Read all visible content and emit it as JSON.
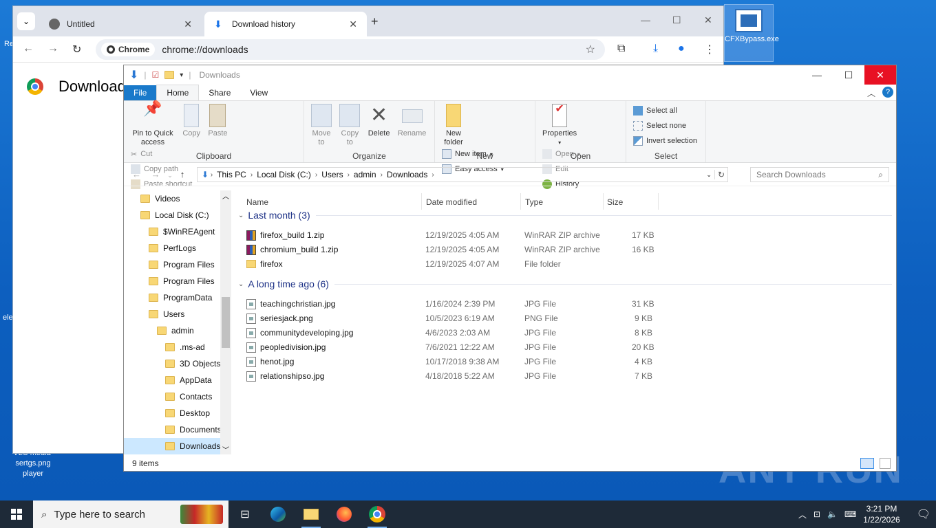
{
  "desktop": {
    "watermark": "ANY RUN",
    "file_icon_label": "CFXBypass.exe",
    "left_labels": [
      "Re",
      "ele",
      "VLC media",
      "player",
      "sertgs.png"
    ]
  },
  "chrome": {
    "tabs": [
      {
        "label": "Untitled"
      },
      {
        "label": "Download history"
      }
    ],
    "chip_label": "Chrome",
    "url": "chrome://downloads",
    "page_title": "Downloads"
  },
  "explorer": {
    "title": "Downloads",
    "ribbon_tabs": [
      "File",
      "Home",
      "Share",
      "View"
    ],
    "clipboard": {
      "pin": "Pin to Quick access",
      "copy": "Copy",
      "paste": "Paste",
      "cut": "Cut",
      "copy_path": "Copy path",
      "paste_shortcut": "Paste shortcut",
      "label": "Clipboard"
    },
    "organize": {
      "move_to": "Move to",
      "copy_to": "Copy to",
      "delete": "Delete",
      "rename": "Rename",
      "label": "Organize"
    },
    "new": {
      "new_folder": "New folder",
      "new_item": "New item",
      "easy_access": "Easy access",
      "label": "New"
    },
    "open": {
      "properties": "Properties",
      "open": "Open",
      "edit": "Edit",
      "history": "History",
      "label": "Open"
    },
    "select": {
      "select_all": "Select all",
      "select_none": "Select none",
      "invert": "Invert selection",
      "label": "Select"
    },
    "breadcrumb": [
      "This PC",
      "Local Disk (C:)",
      "Users",
      "admin",
      "Downloads"
    ],
    "search_placeholder": "Search Downloads",
    "nav": [
      {
        "label": "Videos",
        "indent": 1
      },
      {
        "label": "Local Disk (C:)",
        "indent": 1
      },
      {
        "label": "$WinREAgent",
        "indent": 2
      },
      {
        "label": "PerfLogs",
        "indent": 2
      },
      {
        "label": "Program Files",
        "indent": 2
      },
      {
        "label": "Program Files",
        "indent": 2
      },
      {
        "label": "ProgramData",
        "indent": 2
      },
      {
        "label": "Users",
        "indent": 2
      },
      {
        "label": "admin",
        "indent": 3
      },
      {
        "label": ".ms-ad",
        "indent": 4
      },
      {
        "label": "3D Objects",
        "indent": 4
      },
      {
        "label": "AppData",
        "indent": 4
      },
      {
        "label": "Contacts",
        "indent": 4
      },
      {
        "label": "Desktop",
        "indent": 4
      },
      {
        "label": "Documents",
        "indent": 4
      },
      {
        "label": "Downloads",
        "indent": 4
      }
    ],
    "columns": [
      "Name",
      "Date modified",
      "Type",
      "Size"
    ],
    "groups": [
      {
        "title": "Last month (3)",
        "files": [
          {
            "name": "firefox_build 1.zip",
            "date": "12/19/2025 4:05 AM",
            "type": "WinRAR ZIP archive",
            "size": "17 KB",
            "icon": "zip"
          },
          {
            "name": "chromium_build 1.zip",
            "date": "12/19/2025 4:05 AM",
            "type": "WinRAR ZIP archive",
            "size": "16 KB",
            "icon": "zip"
          },
          {
            "name": "firefox",
            "date": "12/19/2025 4:07 AM",
            "type": "File folder",
            "size": "",
            "icon": "folder"
          }
        ]
      },
      {
        "title": "A long time ago (6)",
        "files": [
          {
            "name": "teachingchristian.jpg",
            "date": "1/16/2024 2:39 PM",
            "type": "JPG File",
            "size": "31 KB",
            "icon": "img"
          },
          {
            "name": "seriesjack.png",
            "date": "10/5/2023 6:19 AM",
            "type": "PNG File",
            "size": "9 KB",
            "icon": "img"
          },
          {
            "name": "communitydeveloping.jpg",
            "date": "4/6/2023 2:03 AM",
            "type": "JPG File",
            "size": "8 KB",
            "icon": "img"
          },
          {
            "name": "peopledivision.jpg",
            "date": "7/6/2021 12:22 AM",
            "type": "JPG File",
            "size": "20 KB",
            "icon": "img"
          },
          {
            "name": "henot.jpg",
            "date": "10/17/2018 9:38 AM",
            "type": "JPG File",
            "size": "4 KB",
            "icon": "img"
          },
          {
            "name": "relationshipso.jpg",
            "date": "4/18/2018 5:22 AM",
            "type": "JPG File",
            "size": "7 KB",
            "icon": "img"
          }
        ]
      }
    ],
    "status": "9 items"
  },
  "taskbar": {
    "search_placeholder": "Type here to search",
    "time": "3:21 PM",
    "date": "1/22/2026"
  }
}
